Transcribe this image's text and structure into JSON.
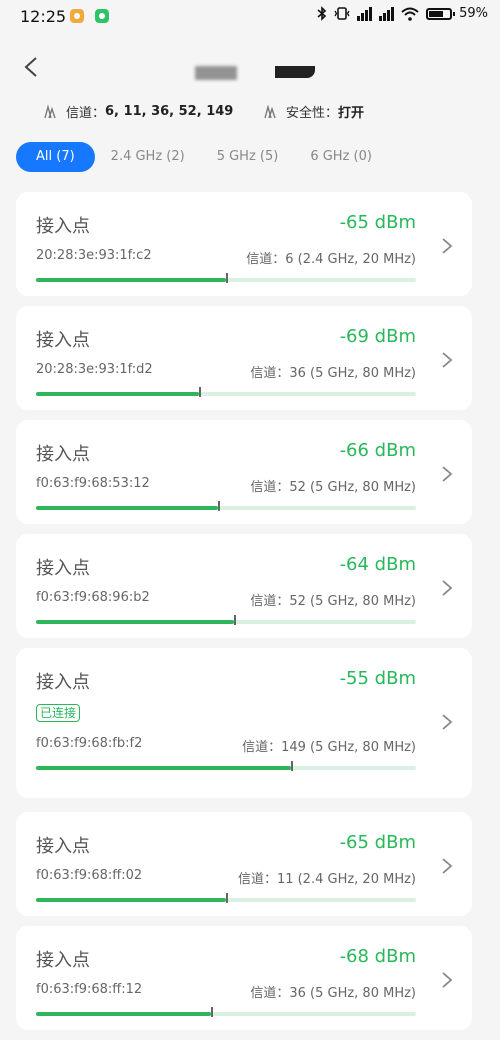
{
  "status_bar": {
    "time": "12:25",
    "battery": "59%"
  },
  "header": {
    "info": {
      "channels_label": "信道：",
      "channels_value": "6, 11, 36, 52, 149",
      "security_label": "安全性：",
      "security_value": "打开"
    }
  },
  "filters": [
    {
      "label": "All (7)",
      "active": true
    },
    {
      "label": "2.4 GHz (2)",
      "active": false
    },
    {
      "label": "5 GHz (5)",
      "active": false
    },
    {
      "label": "6 GHz (0)",
      "active": false
    }
  ],
  "access_points": [
    {
      "title": "接入点",
      "rssi": "-65 dBm",
      "mac": "20:28:3e:93:1f:c2",
      "channel": "信道：6 (2.4 GHz, 20 MHz)",
      "signal": 0.5,
      "connected": false
    },
    {
      "title": "接入点",
      "rssi": "-69 dBm",
      "mac": "20:28:3e:93:1f:d2",
      "channel": "信道：36 (5 GHz, 80 MHz)",
      "signal": 0.43,
      "connected": false
    },
    {
      "title": "接入点",
      "rssi": "-66 dBm",
      "mac": "f0:63:f9:68:53:12",
      "channel": "信道：52 (5 GHz, 80 MHz)",
      "signal": 0.48,
      "connected": false
    },
    {
      "title": "接入点",
      "rssi": "-64 dBm",
      "mac": "f0:63:f9:68:96:b2",
      "channel": "信道：52 (5 GHz, 80 MHz)",
      "signal": 0.52,
      "connected": false
    },
    {
      "title": "接入点",
      "rssi": "-55 dBm",
      "mac": "f0:63:f9:68:fb:f2",
      "channel": "信道：149 (5 GHz, 80 MHz)",
      "signal": 0.67,
      "connected": true,
      "badge": "已连接"
    },
    {
      "title": "接入点",
      "rssi": "-65 dBm",
      "mac": "f0:63:f9:68:ff:02",
      "channel": "信道：11 (2.4 GHz, 20 MHz)",
      "signal": 0.5,
      "connected": false
    },
    {
      "title": "接入点",
      "rssi": "-68 dBm",
      "mac": "f0:63:f9:68:ff:12",
      "channel": "信道：36 (5 GHz, 80 MHz)",
      "signal": 0.46,
      "connected": false
    }
  ],
  "colors": {
    "accent": "#1677ff",
    "signal_green": "#28b85a",
    "track": "#d8f1e0"
  }
}
